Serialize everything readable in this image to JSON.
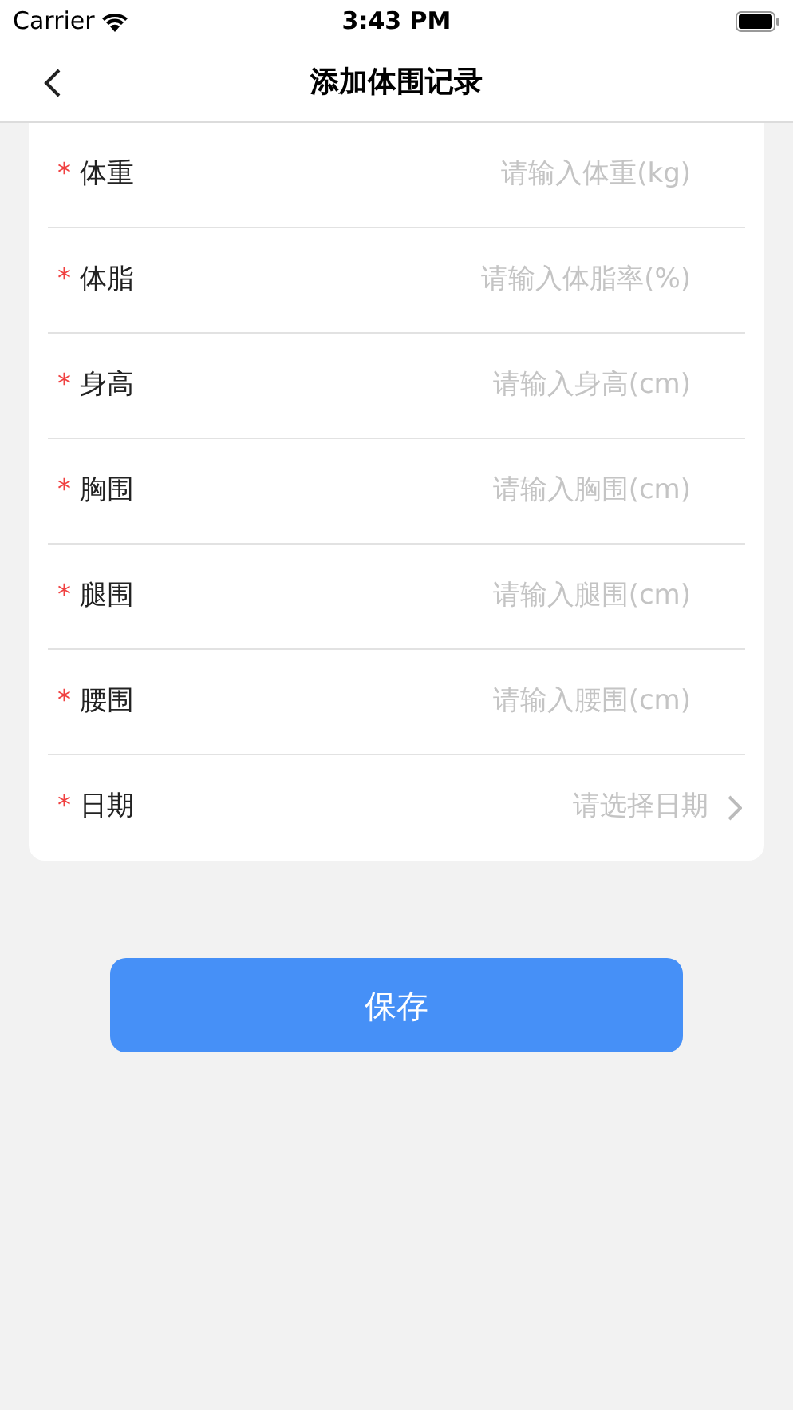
{
  "status_bar": {
    "carrier": "Carrier",
    "time": "3:43 PM"
  },
  "nav": {
    "title": "添加体围记录"
  },
  "fields": [
    {
      "kind": "input",
      "label": "体重",
      "required_mark": "*",
      "placeholder": "请输入体重(kg)"
    },
    {
      "kind": "input",
      "label": "体脂",
      "required_mark": "*",
      "placeholder": "请输入体脂率(%)"
    },
    {
      "kind": "input",
      "label": "身高",
      "required_mark": "*",
      "placeholder": "请输入身高(cm)"
    },
    {
      "kind": "input",
      "label": "胸围",
      "required_mark": "*",
      "placeholder": "请输入胸围(cm)"
    },
    {
      "kind": "input",
      "label": "腿围",
      "required_mark": "*",
      "placeholder": "请输入腿围(cm)"
    },
    {
      "kind": "input",
      "label": "腰围",
      "required_mark": "*",
      "placeholder": "请输入腰围(cm)"
    },
    {
      "kind": "select",
      "label": "日期",
      "required_mark": "*",
      "placeholder": "请选择日期"
    }
  ],
  "save_button": "保存"
}
